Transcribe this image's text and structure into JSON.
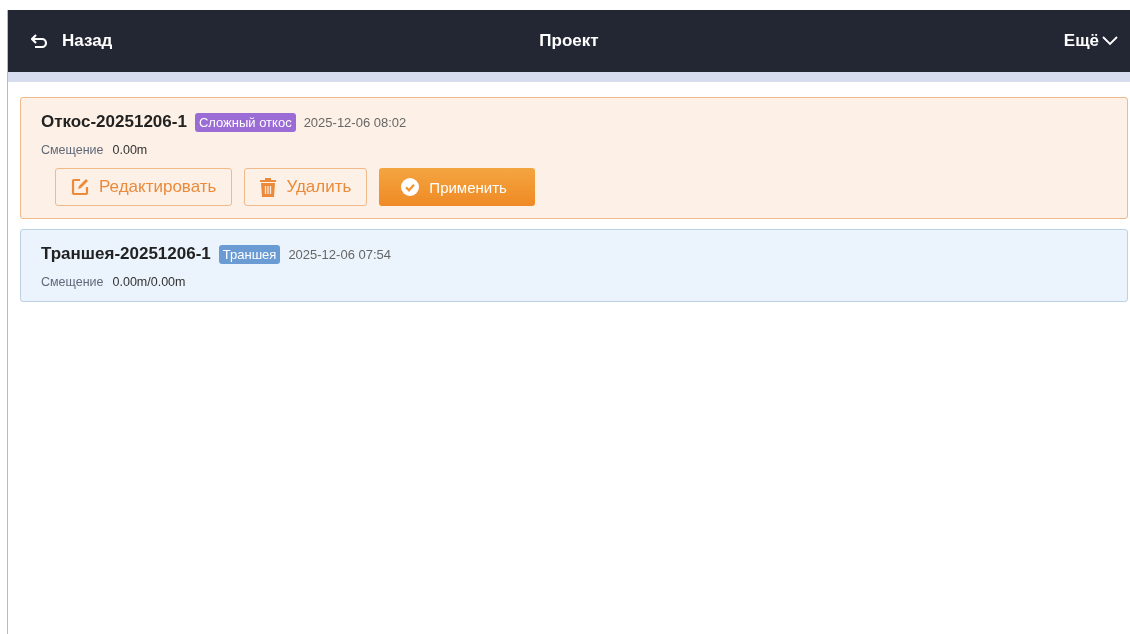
{
  "header": {
    "back": "Назад",
    "title": "Проект",
    "more": "Ещё"
  },
  "projects": [
    {
      "name": "Откос-20251206-1",
      "tag": "Сложный откос",
      "color": "#9b6bd6",
      "time": "2025-12-06 08:02",
      "offset_label": "Смещение",
      "offset": "0.00m",
      "selected": true,
      "actions": [
        {
          "kind": "edit",
          "label": "Редактировать"
        },
        {
          "kind": "delete",
          "label": "Удалить"
        },
        {
          "kind": "apply",
          "label": "Применить"
        }
      ]
    },
    {
      "name": "Траншея-20251206-1",
      "tag": "Траншея",
      "color": "#6a9bd3",
      "time": "2025-12-06 07:54",
      "offset_label": "Смещение",
      "offset": "0.00m/0.00m",
      "selected": false
    }
  ]
}
